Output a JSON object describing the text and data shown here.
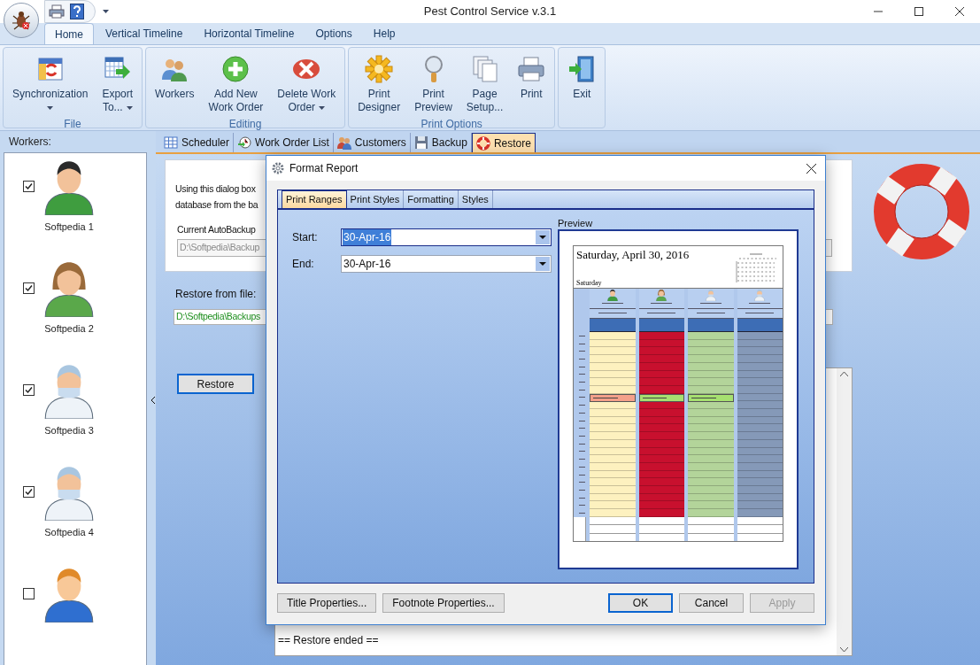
{
  "window": {
    "title": "Pest Control Service v.3.1"
  },
  "ribbon_tabs": [
    {
      "label": "Home",
      "selected": true
    },
    {
      "label": "Vertical Timeline",
      "selected": false
    },
    {
      "label": "Horizontal Timeline",
      "selected": false
    },
    {
      "label": "Options",
      "selected": false
    },
    {
      "label": "Help",
      "selected": false
    }
  ],
  "ribbon_groups": [
    {
      "label": "File",
      "items": [
        {
          "lines": [
            "Synchronization"
          ],
          "dropdown": true
        },
        {
          "lines": [
            "Export",
            "To..."
          ],
          "dropdown": true
        }
      ]
    },
    {
      "label": "Editing",
      "items": [
        {
          "lines": [
            "Workers"
          ],
          "dropdown": false
        },
        {
          "lines": [
            "Add New",
            "Work Order"
          ],
          "dropdown": false
        },
        {
          "lines": [
            "Delete Work",
            "Order"
          ],
          "dropdown": true
        }
      ]
    },
    {
      "label": "Print Options",
      "items": [
        {
          "lines": [
            "Print",
            "Designer"
          ],
          "dropdown": false
        },
        {
          "lines": [
            "Print",
            "Preview"
          ],
          "dropdown": false
        },
        {
          "lines": [
            "Page",
            "Setup..."
          ],
          "dropdown": false
        },
        {
          "lines": [
            "Print"
          ],
          "dropdown": false
        }
      ]
    },
    {
      "items": [
        {
          "lines": [
            "Exit"
          ],
          "dropdown": false
        }
      ]
    }
  ],
  "workers_panel": {
    "title": "Workers:",
    "workers": [
      {
        "name": "Softpedia 1",
        "checked": true
      },
      {
        "name": "Softpedia 2",
        "checked": true
      },
      {
        "name": "Softpedia 3",
        "checked": true
      },
      {
        "name": "Softpedia 4",
        "checked": true
      },
      {
        "checked": false
      }
    ]
  },
  "doc_tabs": [
    {
      "label": "Scheduler",
      "selected": false
    },
    {
      "label": "Work Order List",
      "selected": false
    },
    {
      "label": "Customers",
      "selected": false
    },
    {
      "label": "Backup",
      "selected": false
    },
    {
      "label": "Restore",
      "selected": true
    }
  ],
  "restore_panel": {
    "intro_lines": [
      "Using this dialog box",
      "database from the ba"
    ],
    "autobackup_label": "Current AutoBackup",
    "autobackup_value": "D:\\Softpedia\\Backup",
    "restore_label": "Restore from file:",
    "restore_value": "D:\\Softpedia\\Backups",
    "restore_button": "Restore",
    "log_line": "== Restore ended =="
  },
  "dialog": {
    "title": "Format Report",
    "tabs": [
      {
        "label": "Print Ranges",
        "selected": true
      },
      {
        "label": "Print Styles",
        "selected": false
      },
      {
        "label": "Formatting",
        "selected": false
      },
      {
        "label": "Styles",
        "selected": false
      }
    ],
    "fields": [
      {
        "label": "Start:",
        "value": "30-Apr-16",
        "highlighted": true
      },
      {
        "label": "End:",
        "value": "30-Apr-16",
        "highlighted": false
      }
    ],
    "preview": {
      "label": "Preview",
      "title": "Saturday, April 30, 2016",
      "subtitle": "Saturday",
      "columns": [
        {
          "color": "#fdf1bf",
          "event": {
            "color": "#f4a08a"
          }
        },
        {
          "color": "#c8102e",
          "event": {
            "color": "#a6e070"
          }
        },
        {
          "color": "#b3d49a",
          "event": {
            "color": "#a6e070"
          }
        },
        {
          "color": "#8599b8"
        }
      ]
    },
    "buttons": [
      {
        "label": "Title Properties...",
        "kind": "normal",
        "disabled": false
      },
      {
        "label": "Footnote Properties...",
        "kind": "normal",
        "disabled": false
      },
      {
        "label": "OK",
        "kind": "default",
        "disabled": false
      },
      {
        "label": "Cancel",
        "kind": "normal",
        "disabled": false
      },
      {
        "label": "Apply",
        "kind": "normal",
        "disabled": true
      }
    ]
  }
}
